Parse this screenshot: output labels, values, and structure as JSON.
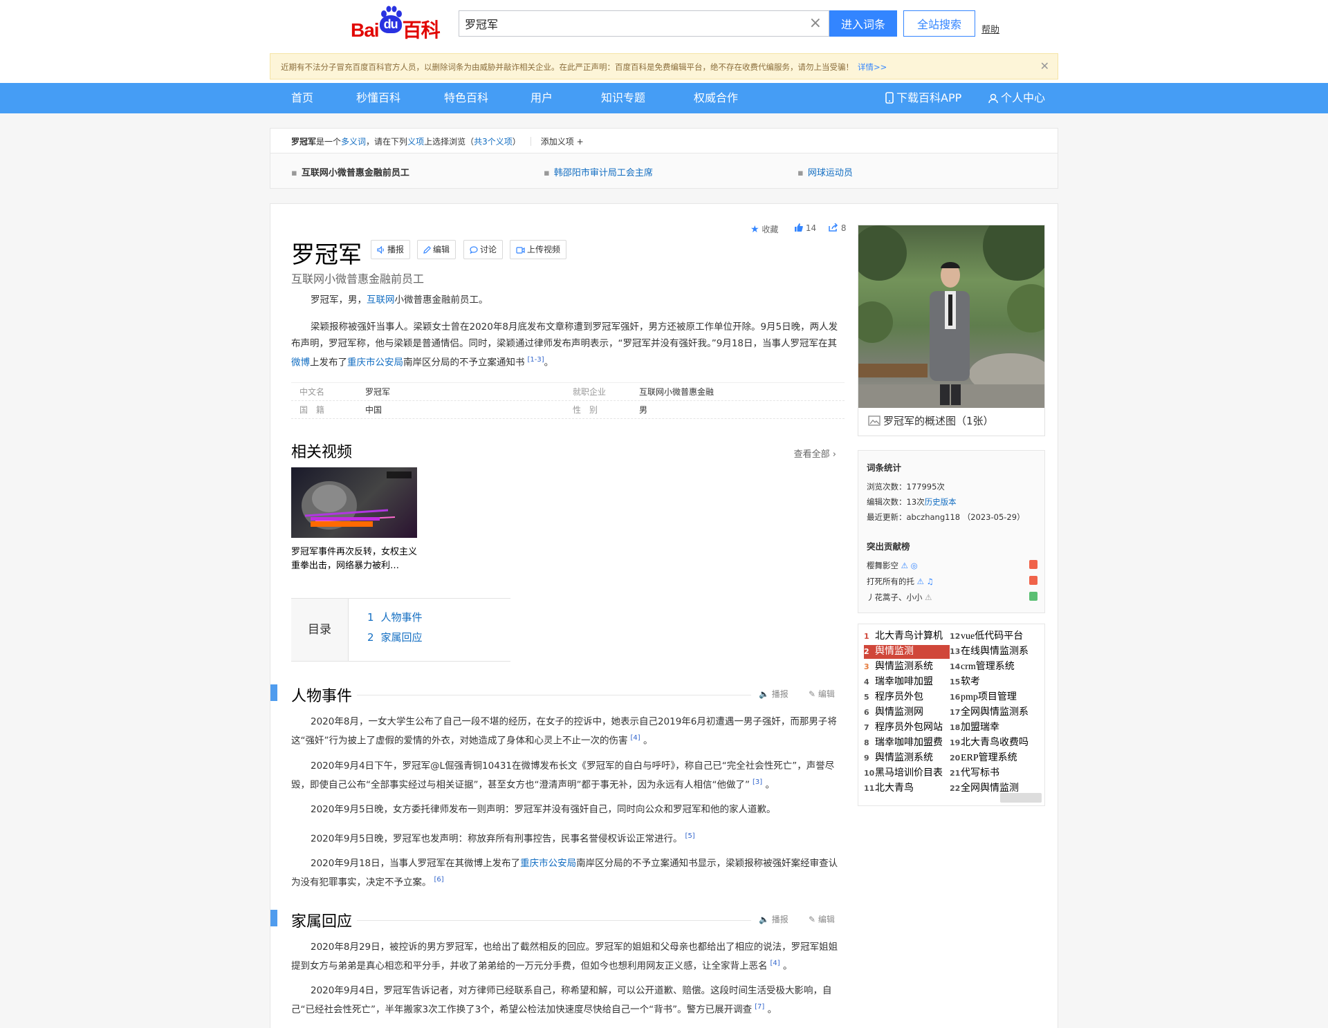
{
  "header": {
    "logo_text": "Baidu百科",
    "search_value": "罗冠军",
    "enter_label": "进入词条",
    "site_search_label": "全站搜索",
    "help_label": "帮助"
  },
  "notice": {
    "text": "近期有不法分子冒充百度百科官方人员，以删除词条为由威胁并敲诈相关企业。在此严正声明：百度百科是免费编辑平台，绝不存在收费代编服务，请勿上当受骗！",
    "more": "详情>>"
  },
  "nav": {
    "items": [
      "首页",
      "秒懂百科",
      "特色百科",
      "用户",
      "知识专题",
      "权威合作"
    ],
    "app": "下载百科APP",
    "personal": "个人中心"
  },
  "polysemy": {
    "term": "罗冠军",
    "text1": "是一个",
    "link1": "多义词",
    "text2": "，请在下列",
    "link2": "义项",
    "text3": "上选择浏览（",
    "link3": "共3个义项",
    "text4": "）",
    "add": "添加义项",
    "items": [
      "互联网小微普惠金融前员工",
      "韩邵阳市审计局工会主席",
      "网球运动员"
    ]
  },
  "article": {
    "title": "罗冠军",
    "buttons": [
      "播报",
      "编辑",
      "讨论",
      "上传视频"
    ],
    "collect": "收藏",
    "likes": "14",
    "shares": "8",
    "subtitle": "互联网小微普惠金融前员工",
    "lead_pre": "罗冠军，男，",
    "lead_link": "互联网",
    "lead_post": "小微普惠金融前员工。",
    "summary_pre": "梁颖报称被强奸当事人。梁颖女士曾在2020年8月底发布文章称遭到罗冠军强奸，男方还被原工作单位开除。9月5日晚，两人发布声明，罗冠军称，他与梁颖是普通情侣。同时，梁颖通过律师发布声明表示，“罗冠军并没有强奸我。”9月18日，当事人罗冠军在其",
    "summary_link1": "微博",
    "summary_mid": "上发布了",
    "summary_link2": "重庆市公安局",
    "summary_post": "南岸区分局的不予立案通知书",
    "summary_ref": "[1-3]",
    "summary_end": "。",
    "basic_info": {
      "k1": "中文名",
      "v1": "罗冠军",
      "k2": "就职企业",
      "v2": "互联网小微普惠金融",
      "k3": "国　籍",
      "v3": "中国",
      "k4": "性　别",
      "v4": "男"
    },
    "video_section": "相关视频",
    "view_all": "查看全部",
    "video_caption": "罗冠军事件再次反转，女权主义重拳出击，网络暴力被利…",
    "toc_label": "目录",
    "toc": [
      {
        "n": "1",
        "t": "人物事件"
      },
      {
        "n": "2",
        "t": "家属回应"
      }
    ],
    "section_tools": {
      "speak": "播报",
      "edit": "编辑"
    },
    "sec1_title": "人物事件",
    "sec1": [
      {
        "t": "2020年8月，一女大学生公布了自己一段不堪的经历，在女子的控诉中，她表示自己2019年6月初遭遇一男子强奸，而那男子将这“强奸”行为披上了虚假的爱情的外衣，对她造成了身体和心灵上不止一次的伤害",
        "ref": "[4]",
        "end": "。"
      },
      {
        "t": "2020年9月4日下午，罗冠军@L倔强青铜10431在微博发布长文《罗冠军的自白与呼吁》，称自己已“完全社会性死亡”，声誉尽毁，即使自己公布“全部事实经过与相关证据”，甚至女方也“澄清声明”都于事无补，因为永远有人相信“他做了”",
        "ref": "[3]",
        "end": "。"
      },
      {
        "t": "2020年9月5日晚，女方委托律师发布一则声明：罗冠军并没有强奸自己，同时向公众和罗冠军和他的家人道歉。",
        "ref": "",
        "end": ""
      },
      {
        "t": "2020年9月5日晚，罗冠军也发声明：称放弃所有刑事控告，民事名誉侵权诉讼正常进行。",
        "ref": "[5]",
        "end": ""
      }
    ],
    "sec1_last_pre": "2020年9月18日，当事人罗冠军在其微博上发布了",
    "sec1_last_link": "重庆市公安局",
    "sec1_last_post": "南岸区分局的不予立案通知书显示，梁颖报称被强奸案经审查认为没有犯罪事实，决定不予立案。",
    "sec1_last_ref": "[6]",
    "sec2_title": "家属回应",
    "sec2": [
      {
        "t": "2020年8月29日，被控诉的男方罗冠军，也给出了截然相反的回应。罗冠军的姐姐和父母亲也都给出了相应的说法，罗冠军姐姐提到女方与弟弟是真心相恋和平分手，并收了弟弟给的一万元分手费，但如今也想利用网友正义感，让全家背上恶名",
        "ref": "[4]",
        "end": "。"
      },
      {
        "t": "2020年9月4日，罗冠军告诉记者，对方律师已经联系自己，称希望和解，可以公开道歉、赔偿。这段时间生活受极大影响，自己“已经社会性死亡”，半年搬家3次工作换了3个，希望公检法加快速度尽快给自己一个“背书”。警方已展开调查",
        "ref": "[7]",
        "end": "。"
      }
    ]
  },
  "sidebar": {
    "photo_caption": "罗冠军的概述图（1张）",
    "stats_title": "词条统计",
    "views": "浏览次数：177995次",
    "edits_pre": "编辑次数：13次",
    "edits_link": "历史版本",
    "updated": "最近更新：abczhang118 （2023-05-29）",
    "contrib_title": "突出贡献榜",
    "contributors": [
      "樱舞影空",
      "打死所有的托",
      "丿花蒿子、小小"
    ],
    "ranking": [
      {
        "n": "1",
        "t": "北大青鸟计算机"
      },
      {
        "n": "2",
        "t": "舆情监测"
      },
      {
        "n": "3",
        "t": "舆情监测系统"
      },
      {
        "n": "4",
        "t": "瑞幸咖啡加盟"
      },
      {
        "n": "5",
        "t": "程序员外包"
      },
      {
        "n": "6",
        "t": "舆情监测网"
      },
      {
        "n": "7",
        "t": "程序员外包网站"
      },
      {
        "n": "8",
        "t": "瑞幸咖啡加盟费"
      },
      {
        "n": "9",
        "t": "舆情监测系统"
      },
      {
        "n": "10",
        "t": "黑马培训价目表"
      },
      {
        "n": "11",
        "t": "北大青鸟"
      },
      {
        "n": "12",
        "t": "vue低代码平台"
      },
      {
        "n": "13",
        "t": "在线舆情监测系"
      },
      {
        "n": "14",
        "t": "crm管理系统"
      },
      {
        "n": "15",
        "t": "软考"
      },
      {
        "n": "16",
        "t": "pmp项目管理"
      },
      {
        "n": "17",
        "t": "全网舆情监测系"
      },
      {
        "n": "18",
        "t": "加盟瑞幸"
      },
      {
        "n": "19",
        "t": "北大青鸟收费吗"
      },
      {
        "n": "20",
        "t": "ERP管理系统"
      },
      {
        "n": "21",
        "t": "代写标书"
      },
      {
        "n": "22",
        "t": "全网舆情监测"
      }
    ]
  },
  "colors": {
    "nav": "#459df5",
    "accent": "#3385ff",
    "link": "#136ec2",
    "rank_highlight": "#d0473a"
  }
}
